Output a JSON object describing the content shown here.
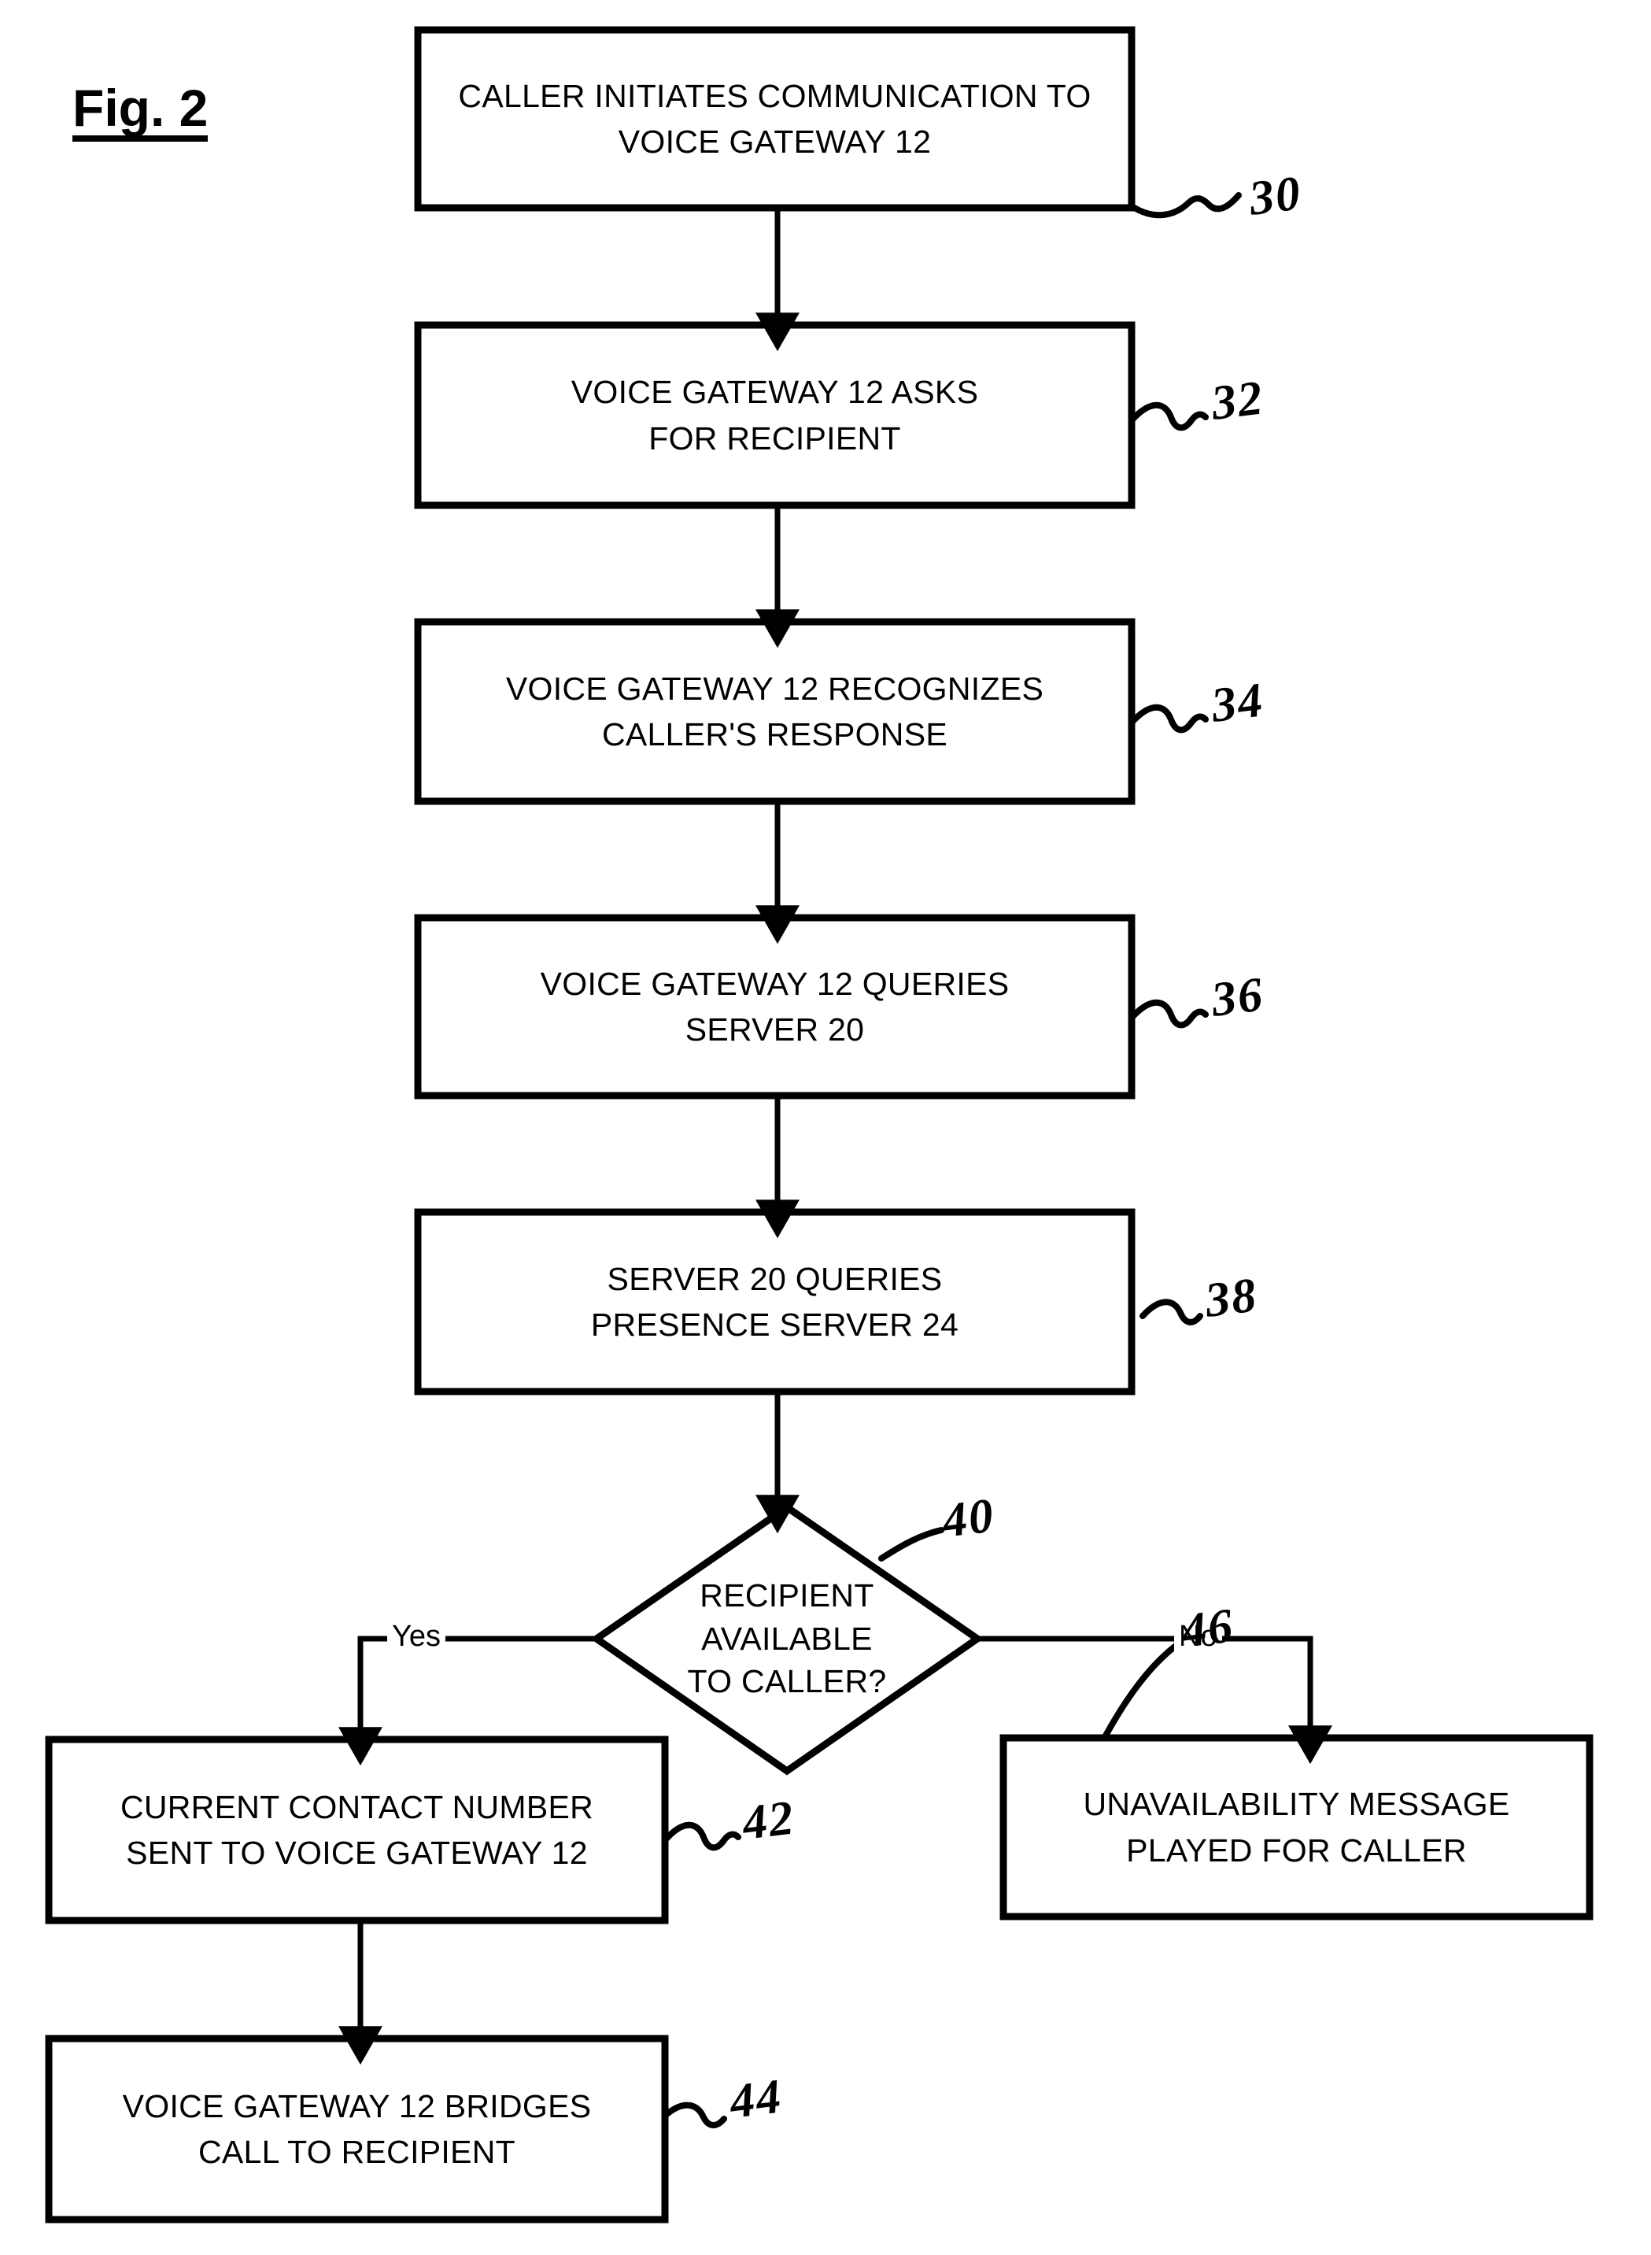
{
  "figure": {
    "title": "Fig. 2",
    "type": "flowchart",
    "background_color": "#ffffff",
    "line_color": "#000000"
  },
  "nodes": [
    {
      "id": "30",
      "shape": "process",
      "text": "CALLER INITIATES COMMUNICATION TO\nVOICE GATEWAY 12",
      "ref": "30"
    },
    {
      "id": "32",
      "shape": "process",
      "text": "VOICE GATEWAY 12 ASKS\nFOR RECIPIENT",
      "ref": "32"
    },
    {
      "id": "34",
      "shape": "process",
      "text": "VOICE GATEWAY 12 RECOGNIZES\nCALLER'S RESPONSE",
      "ref": "34"
    },
    {
      "id": "36",
      "shape": "process",
      "text": "VOICE GATEWAY 12 QUERIES\nSERVER 20",
      "ref": "36"
    },
    {
      "id": "38",
      "shape": "process",
      "text": "SERVER 20 QUERIES\nPRESENCE SERVER 24",
      "ref": "38"
    },
    {
      "id": "40",
      "shape": "decision",
      "text": "RECIPIENT\nAVAILABLE\nTO CALLER?",
      "ref": "40"
    },
    {
      "id": "42",
      "shape": "process",
      "text": "CURRENT CONTACT NUMBER\nSENT TO VOICE GATEWAY 12",
      "ref": "42"
    },
    {
      "id": "44",
      "shape": "process",
      "text": "VOICE GATEWAY 12 BRIDGES\nCALL TO RECIPIENT",
      "ref": "44"
    },
    {
      "id": "46",
      "shape": "process",
      "text": "UNAVAILABILITY MESSAGE\nPLAYED FOR CALLER",
      "ref": "46"
    }
  ],
  "branches": {
    "yes_label": "Yes",
    "no_label": "No"
  }
}
